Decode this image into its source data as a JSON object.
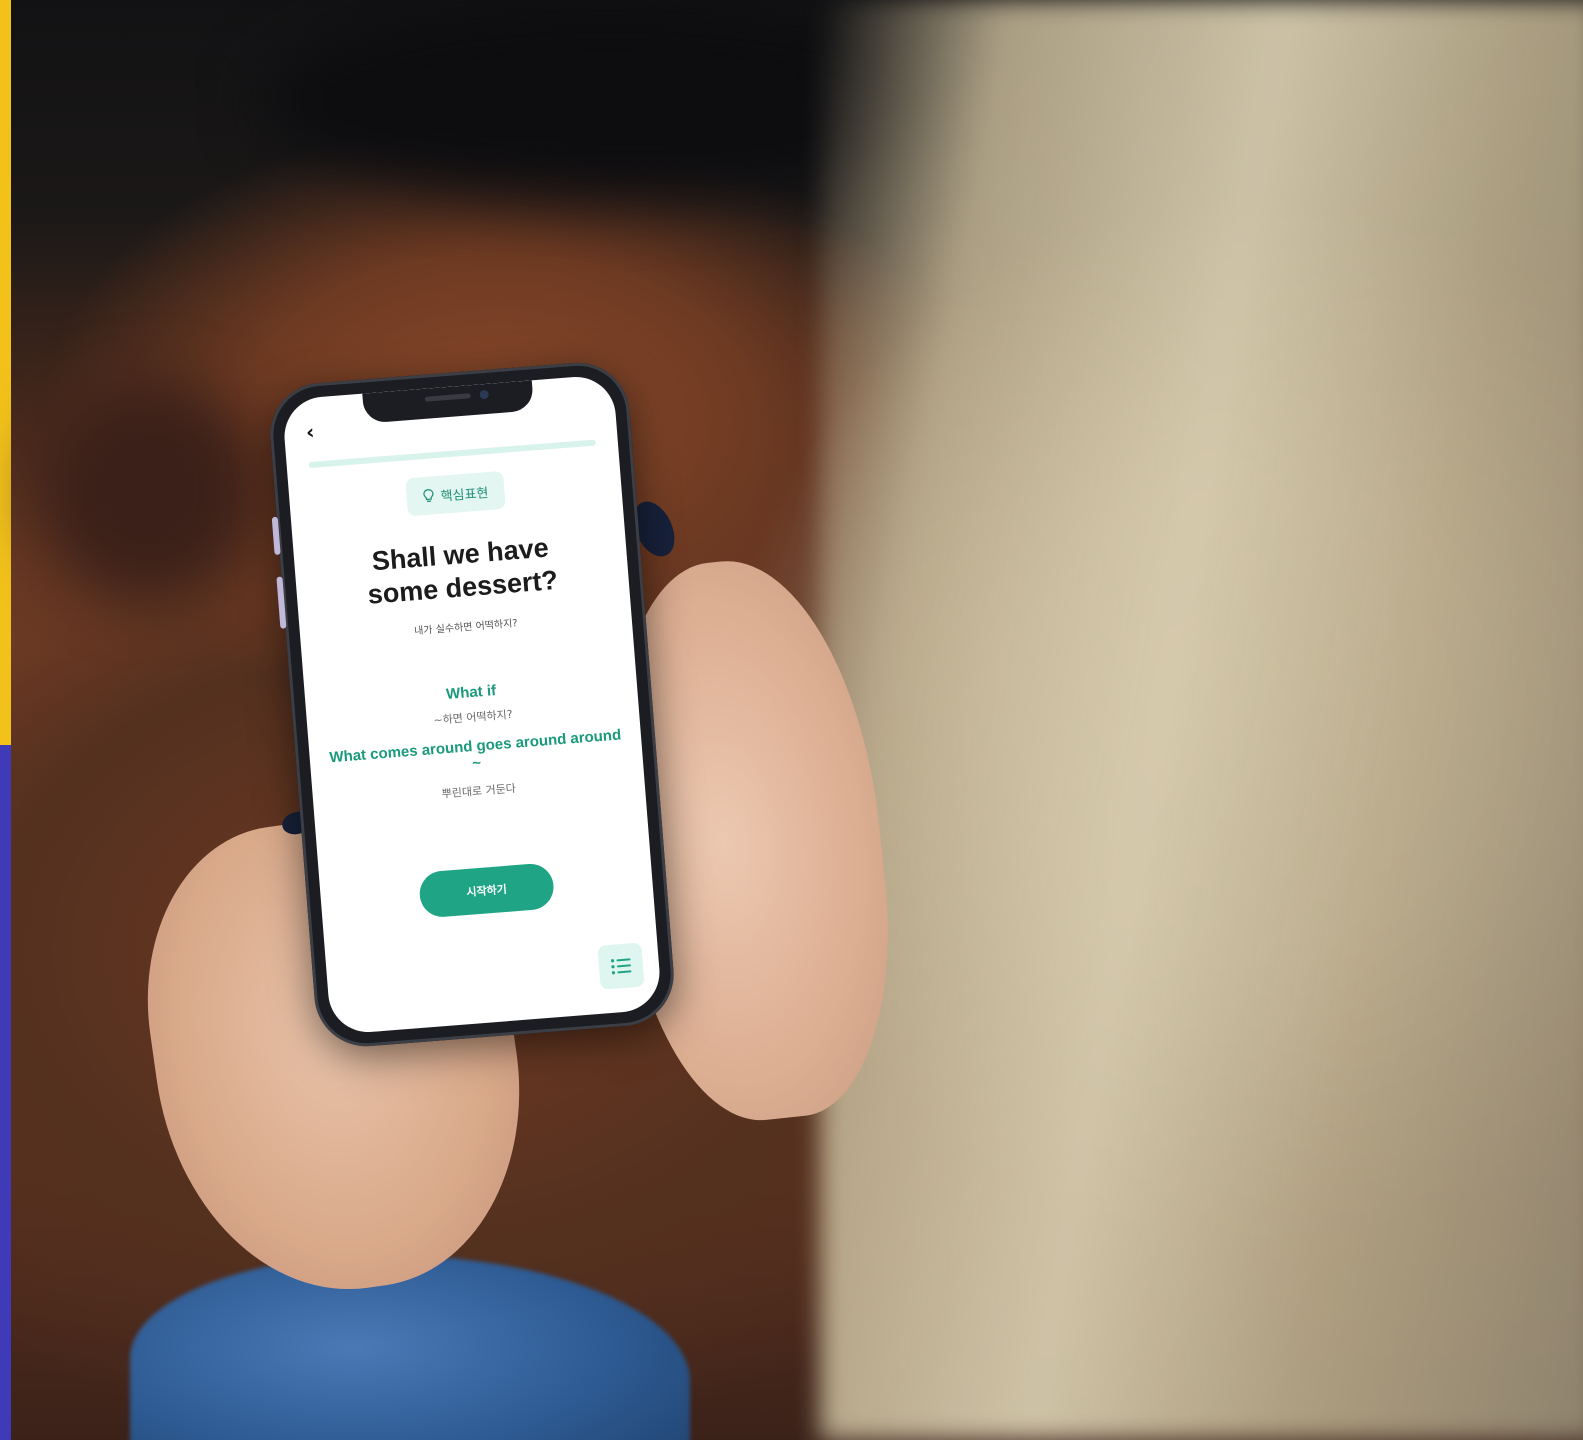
{
  "app": {
    "chip_label": "핵심표현",
    "title": "Shall we have some dessert?",
    "subtitle": "내가 실수하면 어떡하지?",
    "expressions": [
      {
        "en": "What if",
        "ko": "~하면 어떡하지?"
      },
      {
        "en": "What comes around goes around around ~",
        "ko": "뿌린대로 거둔다"
      }
    ],
    "start_label": "시작하기",
    "progress_fraction": 0.0
  },
  "icons": {
    "back": "chevron-left-icon",
    "chip": "lightbulb-icon",
    "list": "list-icon"
  },
  "colors": {
    "accent": "#1fa585",
    "accent_light": "#e3f6f1",
    "left_bar_top": "#f2c21a",
    "left_bar_bottom": "#3f3bb8"
  }
}
